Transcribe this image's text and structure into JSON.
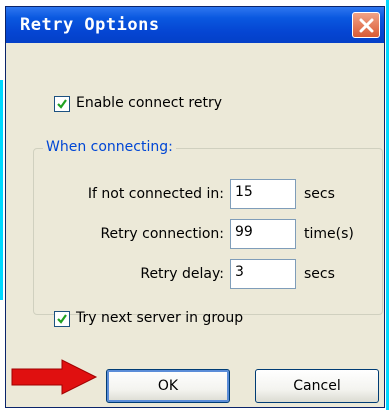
{
  "window": {
    "title": "Retry Options"
  },
  "enable_retry": {
    "checked": true,
    "label": "Enable connect retry"
  },
  "group": {
    "title": "When connecting:",
    "rows": [
      {
        "label": "If not connected in:",
        "value": "15",
        "unit": "secs"
      },
      {
        "label": "Retry connection:",
        "value": "99",
        "unit": "time(s)"
      },
      {
        "label": "Retry delay:",
        "value": "3",
        "unit": "secs"
      }
    ]
  },
  "try_next": {
    "checked": true,
    "label": "Try next server in group"
  },
  "buttons": {
    "ok": "OK",
    "cancel": "Cancel"
  },
  "colors": {
    "title_bar": "#0545d2",
    "dialog_bg": "#ece9d8",
    "arrow": "#e01010",
    "group_title": "#0046d5"
  }
}
